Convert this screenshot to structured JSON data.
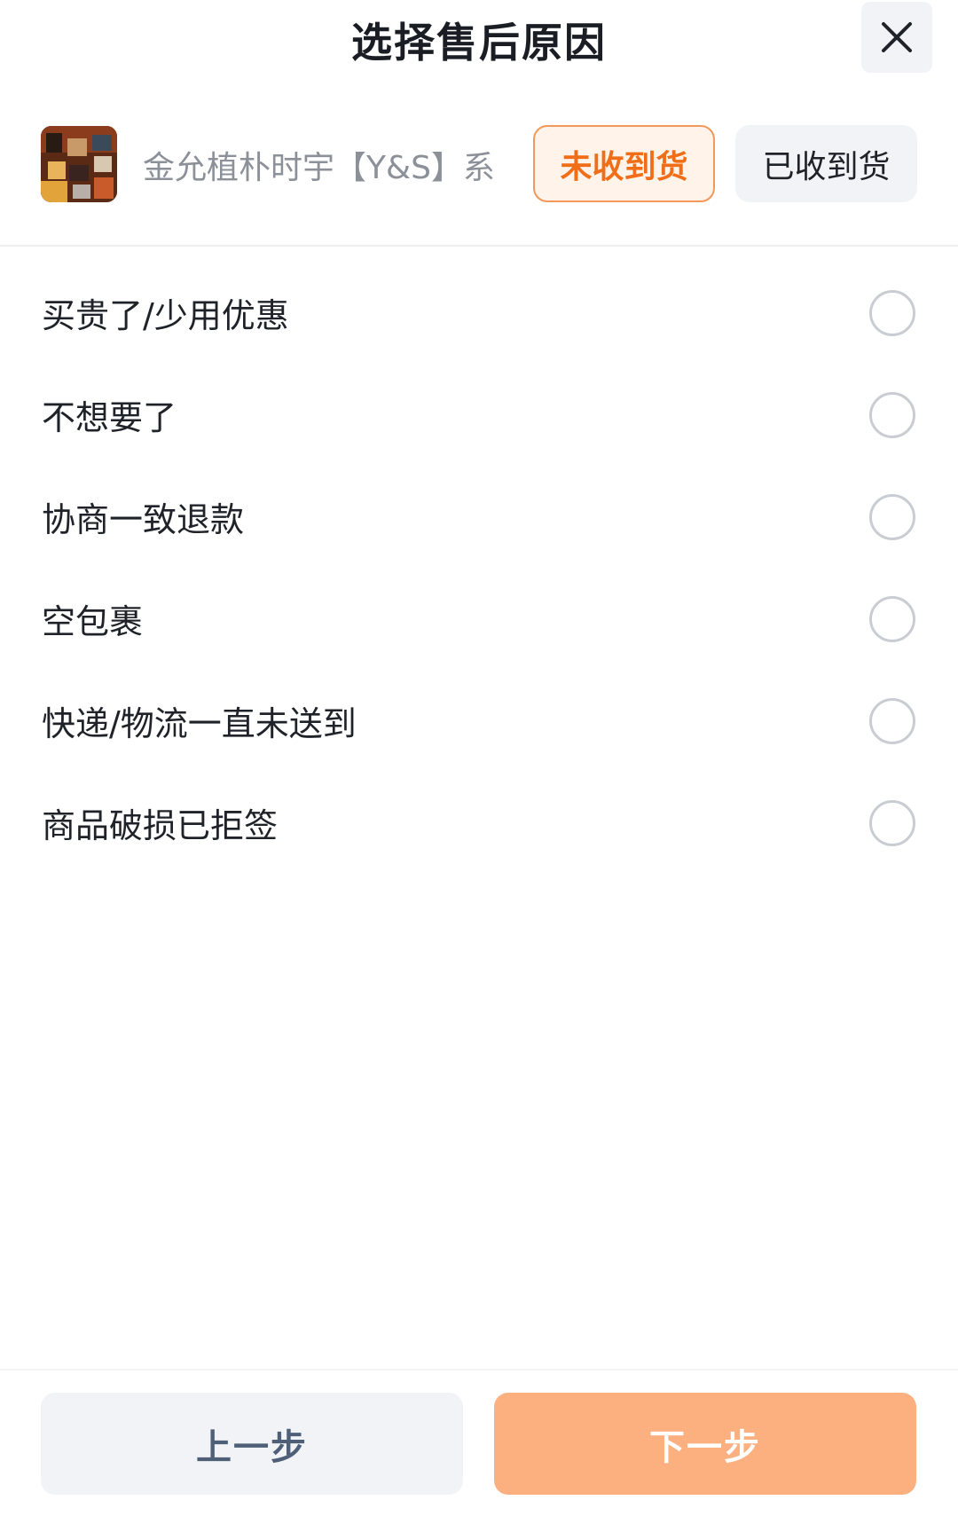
{
  "header": {
    "title": "选择售后原因",
    "close_icon": "close-icon"
  },
  "product": {
    "thumbnail_icon": "product-thumbnail",
    "name": "金允植朴时宇【Y&S】系",
    "tabs": {
      "not_received": "未收到货",
      "received": "已收到货",
      "selected": "not_received"
    }
  },
  "reasons": {
    "items": [
      {
        "label": "买贵了/少用优惠"
      },
      {
        "label": "不想要了"
      },
      {
        "label": "协商一致退款"
      },
      {
        "label": "空包裹"
      },
      {
        "label": "快递/物流一直未送到"
      },
      {
        "label": "商品破损已拒签"
      }
    ]
  },
  "footer": {
    "prev_label": "上一步",
    "next_label": "下一步"
  },
  "colors": {
    "accent": "#f06e17",
    "accent_border": "#f0995a",
    "next_button": "#fdb07f",
    "neutral_button": "#f1f3f6"
  }
}
